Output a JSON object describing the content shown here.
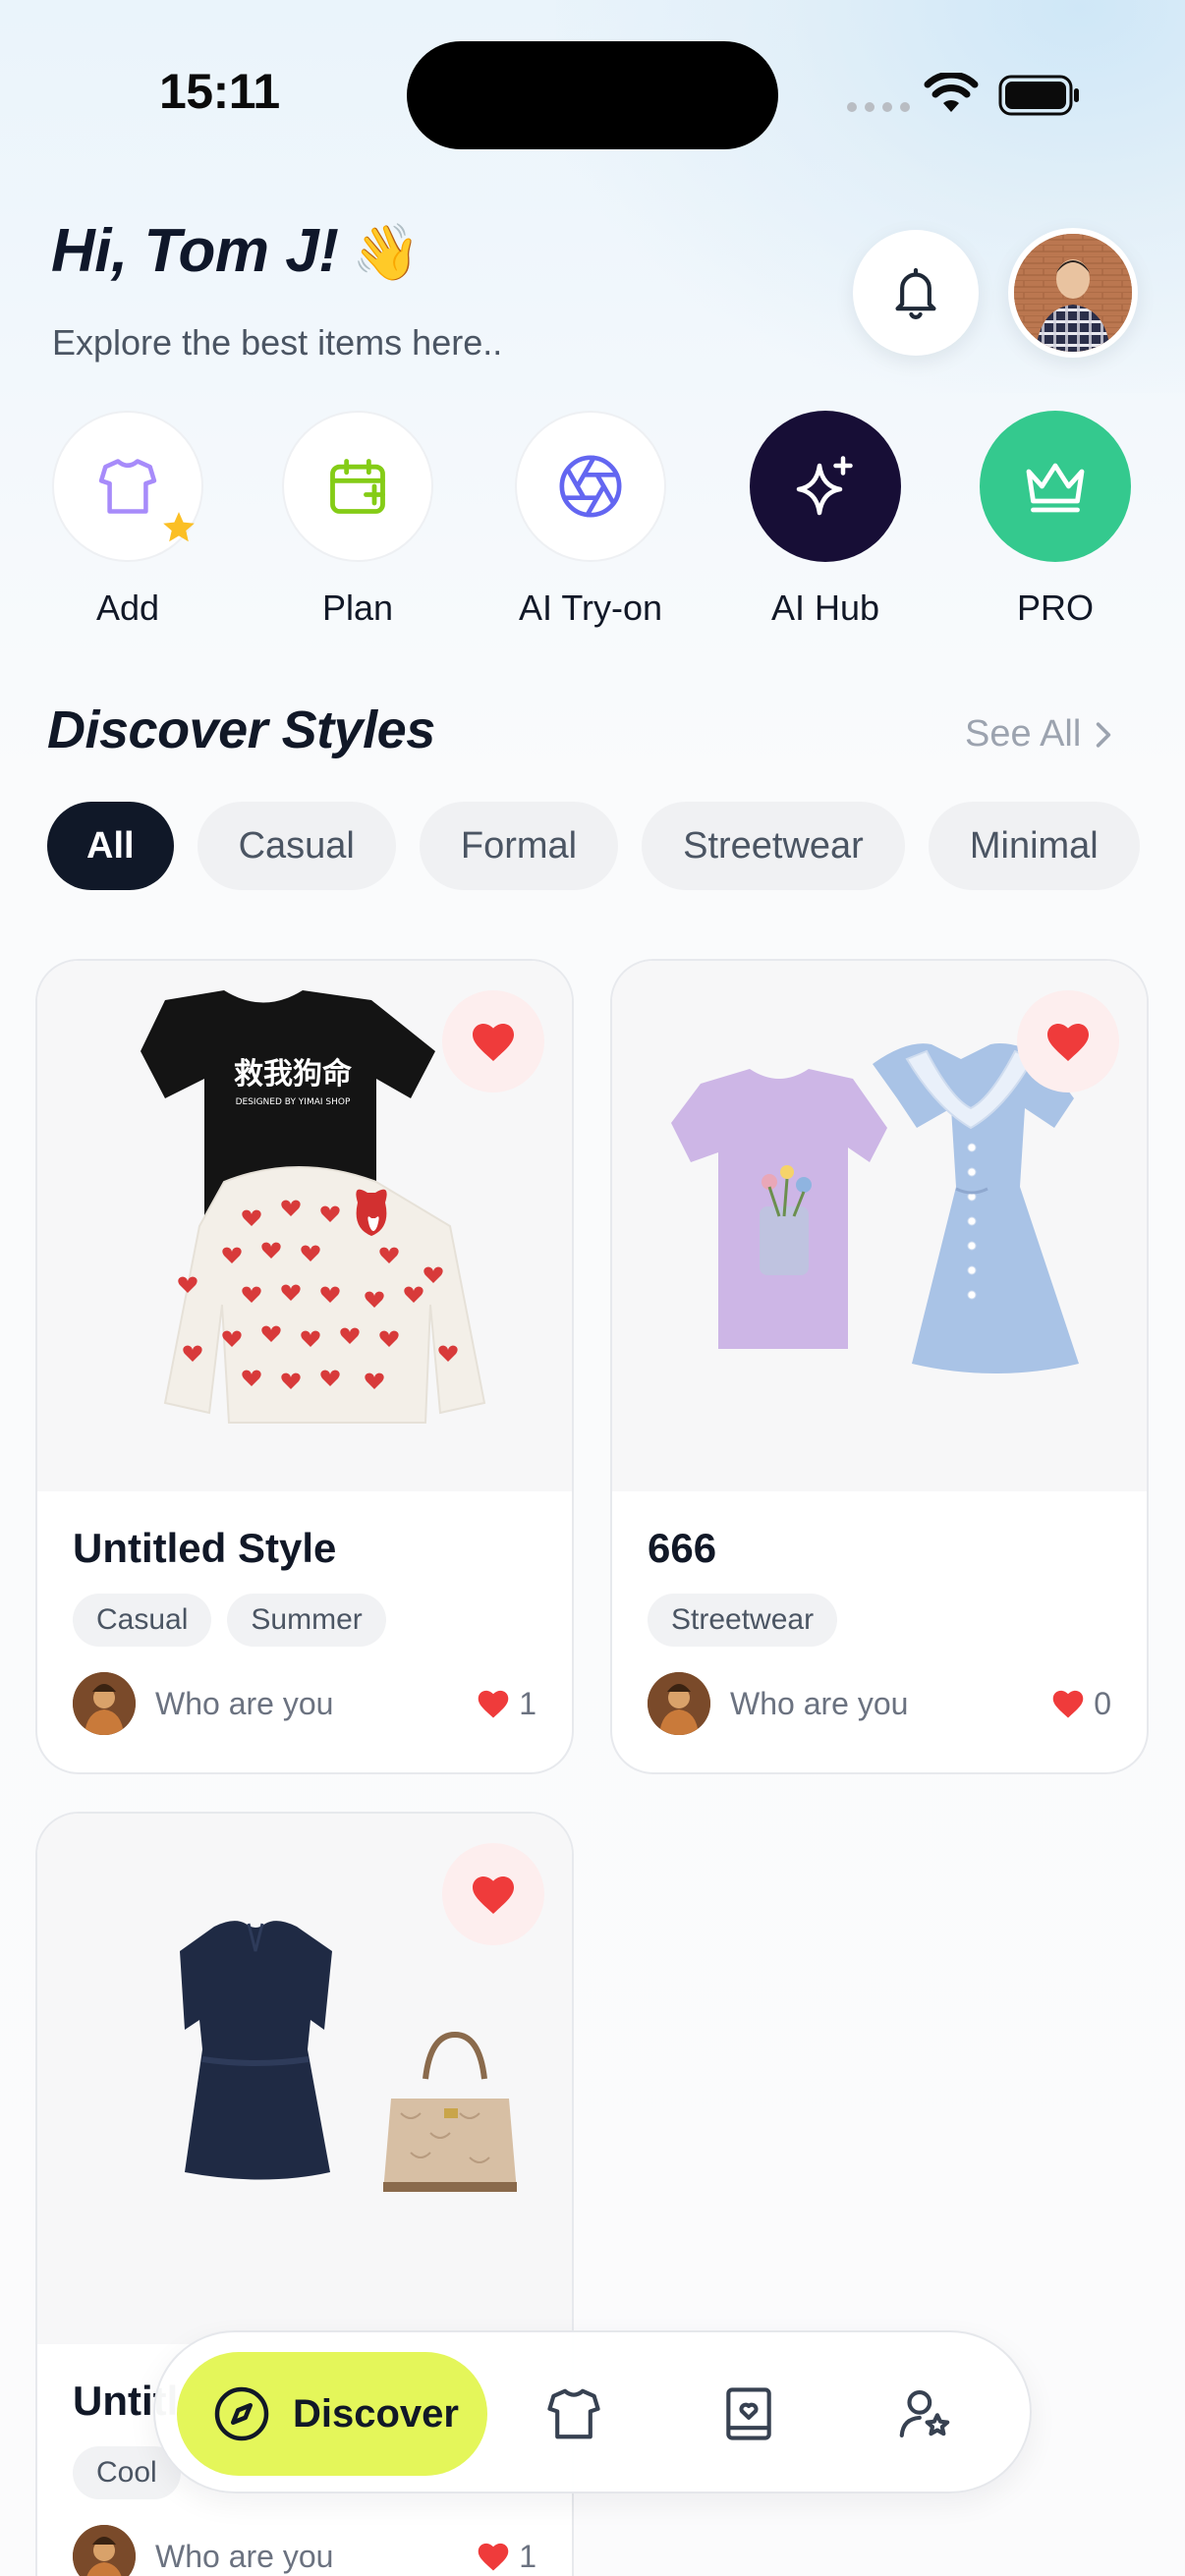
{
  "status_bar": {
    "time": "15:11"
  },
  "header": {
    "greeting": "Hi, Tom J!",
    "greeting_emoji": "👋",
    "subtitle": "Explore the best items here.."
  },
  "quick_actions": [
    {
      "label": "Add",
      "icon": "tshirt-plus-icon"
    },
    {
      "label": "Plan",
      "icon": "calendar-plus-icon"
    },
    {
      "label": "AI Try-on",
      "icon": "aperture-icon"
    },
    {
      "label": "AI Hub",
      "icon": "sparkles-icon"
    },
    {
      "label": "PRO",
      "icon": "crown-icon"
    }
  ],
  "discover": {
    "title": "Discover Styles",
    "see_all": "See All",
    "filters": [
      "All",
      "Casual",
      "Formal",
      "Streetwear",
      "Minimal"
    ],
    "active_filter": "All"
  },
  "cards": [
    {
      "title": "Untitled Style",
      "tags": [
        "Casual",
        "Summer"
      ],
      "owner": "Who are you",
      "likes": "1"
    },
    {
      "title": "666",
      "tags": [
        "Streetwear"
      ],
      "owner": "Who are you",
      "likes": "0"
    },
    {
      "title": "Untitled Style",
      "tags": [
        "Cool"
      ],
      "owner": "Who are you",
      "likes": "1"
    }
  ],
  "bottom_nav": {
    "active_label": "Discover",
    "items": [
      "compass-icon",
      "tshirt-icon",
      "lookbook-icon",
      "user-star-icon"
    ]
  },
  "colors": {
    "accent_lime": "#e4f65a",
    "dark_navy": "#170e36",
    "pro_green": "#34c98e",
    "heart_red": "#ef3b3b",
    "chip_active": "#101828"
  }
}
